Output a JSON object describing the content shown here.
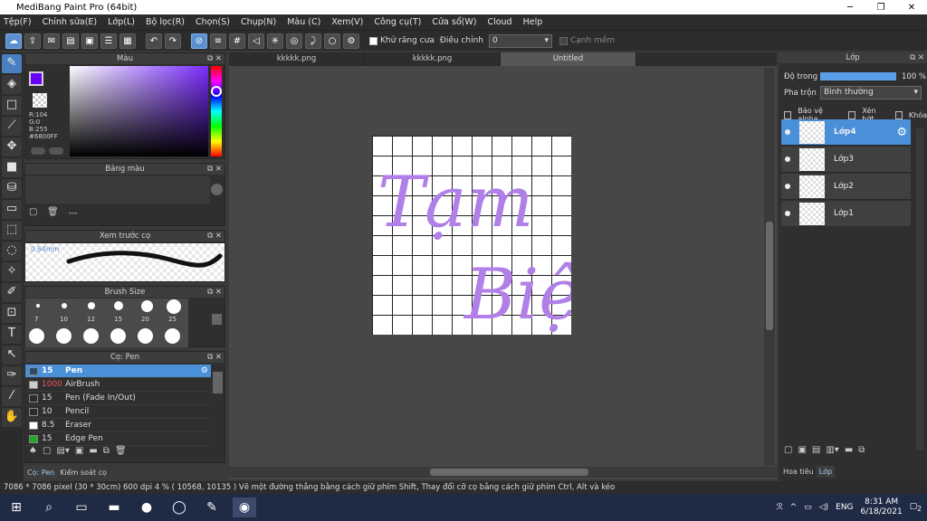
{
  "window": {
    "title": "MediBang Paint Pro (64bit)",
    "controls": [
      "─",
      "❐",
      "✕"
    ]
  },
  "menu": [
    "Tệp(F)",
    "Chỉnh sửa(E)",
    "Lớp(L)",
    "Bộ lọc(R)",
    "Chọn(S)",
    "Chụp(N)",
    "Màu (C)",
    "Xem(V)",
    "Công cụ(T)",
    "Cửa sổ(W)",
    "Cloud",
    "Help"
  ],
  "toolbar": {
    "antialias_label": "Khử răng cưa",
    "adjust_label": "Điều chỉnh",
    "adjust_value": "0",
    "edge_label": "Cạnh mềm"
  },
  "color_panel": {
    "title": "Màu",
    "r": "R:104",
    "g": "G:0",
    "b": "B:255",
    "hex": "#6800FF",
    "fg_color": "#6800FF"
  },
  "palette_panel": {
    "title": "Bảng màu",
    "dash": "---"
  },
  "preview_panel": {
    "title": "Xem trước cọ",
    "size": "0.64mm"
  },
  "brushsize_panel": {
    "title": "Brush Size",
    "sizes": [
      "7",
      "10",
      "12",
      "15",
      "20",
      "25"
    ]
  },
  "brush_panel": {
    "title": "Cọ: Pen",
    "items": [
      {
        "size": "15",
        "name": "Pen",
        "color": "#2c4a6a"
      },
      {
        "size": "1000",
        "name": "AirBrush",
        "color": "#cccccc"
      },
      {
        "size": "15",
        "name": "Pen (Fade In/Out)",
        "color": "#2c2c2c"
      },
      {
        "size": "10",
        "name": "Pencil",
        "color": "#2c2c2c"
      },
      {
        "size": "8.5",
        "name": "Eraser",
        "color": "#ffffff"
      },
      {
        "size": "15",
        "name": "Edge Pen",
        "color": "#22aa22"
      }
    ]
  },
  "left_tabs": [
    "Cọ: Pen",
    "Kiểm soát cọ"
  ],
  "tabs": [
    "kkkkk.png",
    "kkkkk.png",
    "Untitled"
  ],
  "canvas": {
    "text1": "Tạm",
    "text2": "Biệt",
    "ink": "#b07fe8"
  },
  "layer_panel": {
    "title": "Lớp",
    "opacity_label": "Độ trong",
    "opacity_value": "100 %",
    "opacity": 1.0,
    "blend_label": "Pha trộn",
    "blend_value": "Bình thường",
    "protect_alpha": "Bảo vệ alpha",
    "clip": "Xén bớt",
    "lock": "Khóa",
    "layers": [
      "Lớp4",
      "Lớp3",
      "Lớp2",
      "Lớp1"
    ]
  },
  "right_tabs": [
    "Hoa tiêu",
    "Lớp"
  ],
  "status": "7086 * 7086 pixel   (30 * 30cm)   600 dpi   4 %   ( 10568, 10135 )   Vẽ một đường thẳng bằng cách giữ phím Shift, Thay đổi cỡ cọ bằng cách giữ phím Ctrl, Alt và kéo",
  "taskbar": {
    "lang": "ENG",
    "time": "8:31 AM",
    "date": "6/18/2021",
    "notif": "2"
  }
}
